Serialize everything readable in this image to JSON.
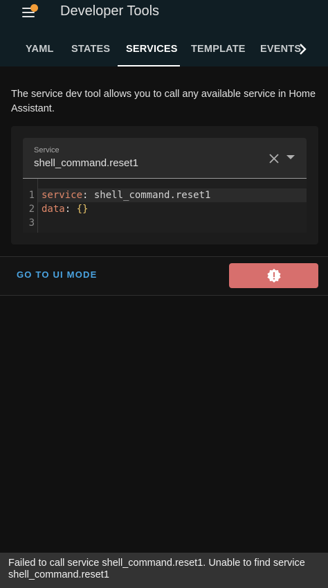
{
  "header": {
    "title": "Developer Tools",
    "menu_icon": "hamburger-menu-icon",
    "notification_dot_color": "#f29d38",
    "background": "#101e24"
  },
  "tabs": [
    {
      "label": "YAML",
      "active": false
    },
    {
      "label": "STATES",
      "active": false
    },
    {
      "label": "SERVICES",
      "active": true
    },
    {
      "label": "TEMPLATE",
      "active": false
    },
    {
      "label": "EVENTS",
      "active": false
    }
  ],
  "tabs_scroll_icon": "chevron-right-icon",
  "description": "The service dev tool allows you to call any available service in Home Assistant.",
  "service_field": {
    "label": "Service",
    "value": "shell_command.reset1",
    "clear_icon": "close-icon",
    "dropdown_icon": "arrow-drop-down-icon"
  },
  "editor": {
    "line_numbers": [
      "1",
      "2",
      "3"
    ],
    "lines": [
      {
        "key": "service",
        "colon": ": ",
        "value": "shell_command.reset1"
      },
      {
        "key": "data",
        "colon": ": ",
        "value": "{}"
      },
      {
        "key": "",
        "colon": "",
        "value": ""
      }
    ]
  },
  "actions": {
    "ui_mode_label": "GO TO UI MODE",
    "call_button_icon": "alert-decagram-icon",
    "call_button_color": "#d76f6d",
    "link_color": "#4aa3e0"
  },
  "toast": {
    "message": "Failed to call service shell_command.reset1. Unable to find service shell_command.reset1"
  }
}
